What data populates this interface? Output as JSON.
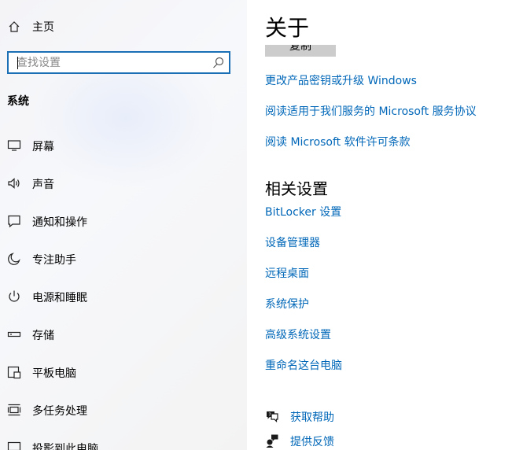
{
  "sidebar": {
    "home_label": "主页",
    "search_placeholder": "查找设置",
    "section_title": "系统",
    "items": [
      {
        "label": "屏幕",
        "icon": "monitor-icon"
      },
      {
        "label": "声音",
        "icon": "speaker-icon"
      },
      {
        "label": "通知和操作",
        "icon": "notification-icon"
      },
      {
        "label": "专注助手",
        "icon": "moon-icon"
      },
      {
        "label": "电源和睡眠",
        "icon": "power-icon"
      },
      {
        "label": "存储",
        "icon": "storage-icon"
      },
      {
        "label": "平板电脑",
        "icon": "tablet-icon"
      },
      {
        "label": "多任务处理",
        "icon": "multitask-icon"
      },
      {
        "label": "投影到此电脑",
        "icon": "project-icon"
      }
    ]
  },
  "main": {
    "title": "关于",
    "copy_button": "复制",
    "links": [
      "更改产品密钥或升级 Windows",
      "阅读适用于我们服务的 Microsoft 服务协议",
      "阅读 Microsoft 软件许可条款"
    ],
    "related_heading": "相关设置",
    "related_links": [
      "BitLocker 设置",
      "设备管理器",
      "远程桌面",
      "系统保护",
      "高级系统设置",
      "重命名这台电脑"
    ],
    "help_items": [
      {
        "label": "获取帮助",
        "icon": "help-chat-icon"
      },
      {
        "label": "提供反馈",
        "icon": "feedback-icon"
      }
    ]
  },
  "colors": {
    "accent": "#0067b8",
    "search_border": "#1a6fb5",
    "sidebar_bg": "#f4f4f7"
  }
}
